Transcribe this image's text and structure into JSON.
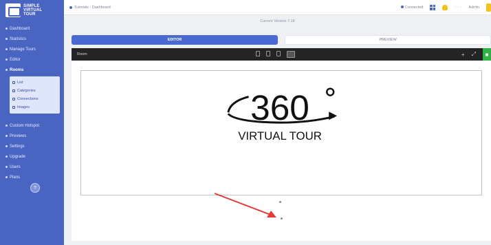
{
  "sidebar": {
    "logo_lines": [
      "SIMPLE",
      "VIRTUAL",
      "TOUR"
    ],
    "items": [
      {
        "label": "Dashboard"
      },
      {
        "label": "Statistics"
      },
      {
        "label": "Manage Tours"
      },
      {
        "label": "Editor"
      },
      {
        "label": "Rooms",
        "active": true
      },
      {
        "label": "Custom Hotspot"
      },
      {
        "label": "Previews"
      },
      {
        "label": "Settings"
      },
      {
        "label": "Upgrade"
      },
      {
        "label": "Users"
      },
      {
        "label": "Plans"
      }
    ],
    "subitems": [
      {
        "label": "List"
      },
      {
        "label": "Categories"
      },
      {
        "label": "Connections"
      },
      {
        "label": "Images"
      }
    ]
  },
  "topbar": {
    "breadcrumb": "Tutorials - Dashboard",
    "status_label": "Connected",
    "user_label": "Admin"
  },
  "main": {
    "subtitle": "Current Version 7.18",
    "tabs": [
      {
        "label": "EDITOR"
      },
      {
        "label": "PREVIEW"
      }
    ],
    "toolbar_label": "Room"
  },
  "logo": {
    "number": "360",
    "caption": "VIRTUAL TOUR"
  },
  "colors": {
    "sidebar": "#4a64c2",
    "accent": "#4a6ad2",
    "toolbar": "#242424",
    "save": "#2fb344",
    "arrow": "#e53935"
  }
}
